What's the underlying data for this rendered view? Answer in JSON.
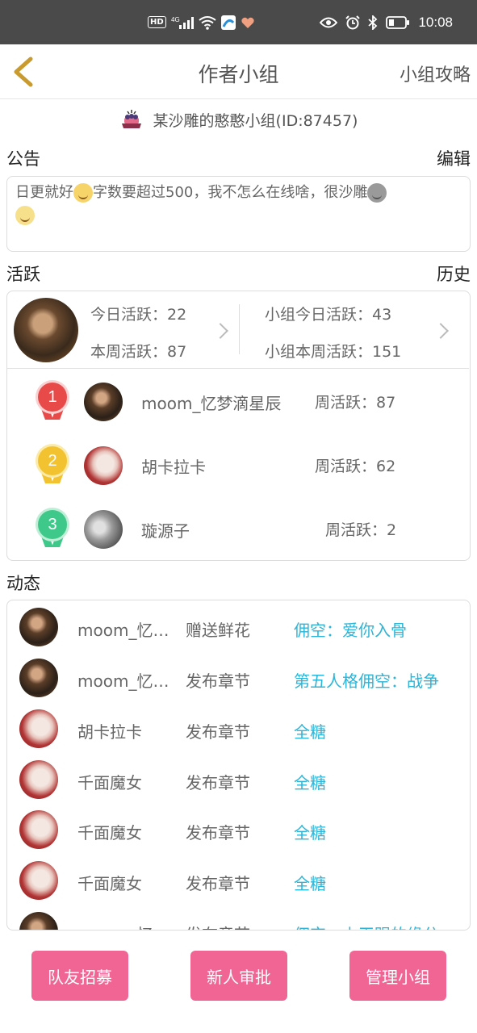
{
  "status_bar": {
    "hd_label": "HD",
    "signal_label": "4G",
    "time": "10:08"
  },
  "nav": {
    "title": "作者小组",
    "right_link": "小组攻略"
  },
  "group": {
    "name_line": "某沙雕的憨憨小组(ID:87457)"
  },
  "notice": {
    "heading": "公告",
    "edit_label": "编辑",
    "text_part1": "日更就好",
    "text_part2": "字数要超过500，我不怎么在线啥，很沙雕"
  },
  "activity": {
    "heading": "活跃",
    "history_label": "历史",
    "today": "今日活跃：22",
    "week": "本周活跃：87",
    "group_today": "小组今日活跃：43",
    "group_week": "小组本周活跃：151",
    "ranking": [
      {
        "rank": "1",
        "name": "moom_忆梦滴星辰",
        "score": "周活跃：87"
      },
      {
        "rank": "2",
        "name": "胡卡拉卡",
        "score": "周活跃：62"
      },
      {
        "rank": "3",
        "name": "璇源子",
        "score": "周活跃：2"
      }
    ]
  },
  "feed": {
    "heading": "动态",
    "items": [
      {
        "name": "moom_忆梦滴星辰",
        "action": "赠送鲜花",
        "target": "佣空：爱你入骨"
      },
      {
        "name": "moom_忆梦滴星辰",
        "action": "发布章节",
        "target": "第五人格佣空：战争"
      },
      {
        "name": "胡卡拉卡",
        "action": "发布章节",
        "target": "全糖"
      },
      {
        "name": "千面魔女",
        "action": "发布章节",
        "target": "全糖"
      },
      {
        "name": "千面魔女",
        "action": "发布章节",
        "target": "全糖"
      },
      {
        "name": "千面魔女",
        "action": "发布章节",
        "target": "全糖"
      },
      {
        "name": "moom_忆梦滴星辰",
        "action": "发布章节",
        "target": "佣空：上天赐的缘分"
      }
    ]
  },
  "buttons": {
    "recruit": "队友招募",
    "approve": "新人审批",
    "manage": "管理小组"
  },
  "colors": {
    "accent_pink": "#f06593",
    "link_blue": "#2bb5d8",
    "medal_gold_1": "#e84a4a",
    "medal_2": "#f2c230",
    "medal_3": "#3ec98a"
  }
}
